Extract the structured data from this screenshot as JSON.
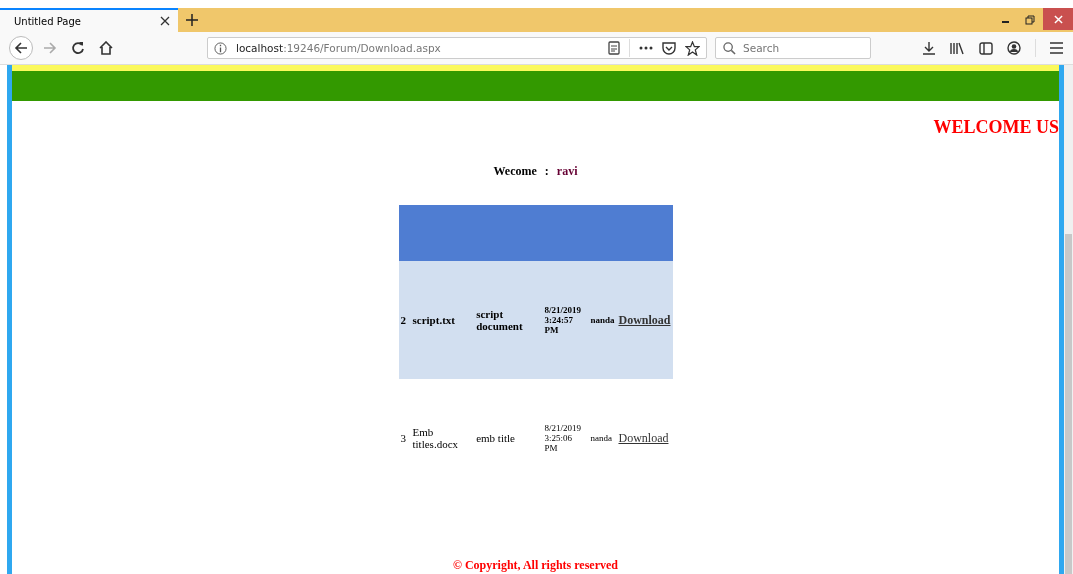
{
  "browser": {
    "tab_title": "Untitled Page",
    "url_host": "localhost",
    "url_path": ":19246/Forum/Download.aspx",
    "search": {
      "placeholder": "Search"
    }
  },
  "page": {
    "banner": "WELCOME US",
    "greeting_label": "Wecome",
    "greeting_separator": ":",
    "user_name": "ravi",
    "table": {
      "rows": [
        {
          "selected": true,
          "cells": [
            "2",
            "script.txt",
            "script document",
            "8/21/2019 3:24:57 PM",
            "nanda"
          ],
          "link": "Download"
        },
        {
          "selected": false,
          "cells": [
            "3",
            "Emb titles.docx",
            "emb title",
            "8/21/2019 3:25:06 PM",
            "nanda"
          ],
          "link": "Download"
        }
      ]
    },
    "footer": "© Copyright, All rights reserved"
  }
}
